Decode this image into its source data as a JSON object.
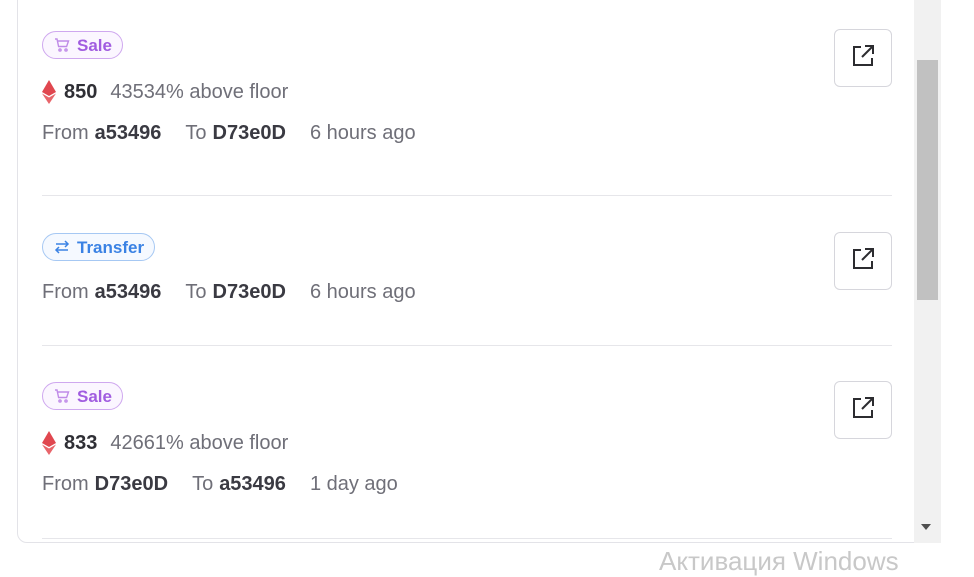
{
  "activity": [
    {
      "type_label": "Sale",
      "type_icon": "cart-icon",
      "price": "850",
      "above_floor": "43534% above floor",
      "from_label": "From",
      "from": "a53496",
      "to_label": "To",
      "to": "D73e0D",
      "time": "6 hours ago"
    },
    {
      "type_label": "Transfer",
      "type_icon": "transfer-arrows-icon",
      "from_label": "From",
      "from": "a53496",
      "to_label": "To",
      "to": "D73e0D",
      "time": "6 hours ago"
    },
    {
      "type_label": "Sale",
      "type_icon": "cart-icon",
      "price": "833",
      "above_floor": "42661% above floor",
      "from_label": "From",
      "from": "D73e0D",
      "to_label": "To",
      "to": "a53496",
      "time": "1 day ago"
    }
  ],
  "icons": {
    "currency": "eth-icon",
    "external_link": "external-link-icon"
  },
  "colors": {
    "sale": "#a15de0",
    "transfer": "#3a82e4",
    "eth": "#e0474f"
  },
  "watermark": "Активация Windows"
}
